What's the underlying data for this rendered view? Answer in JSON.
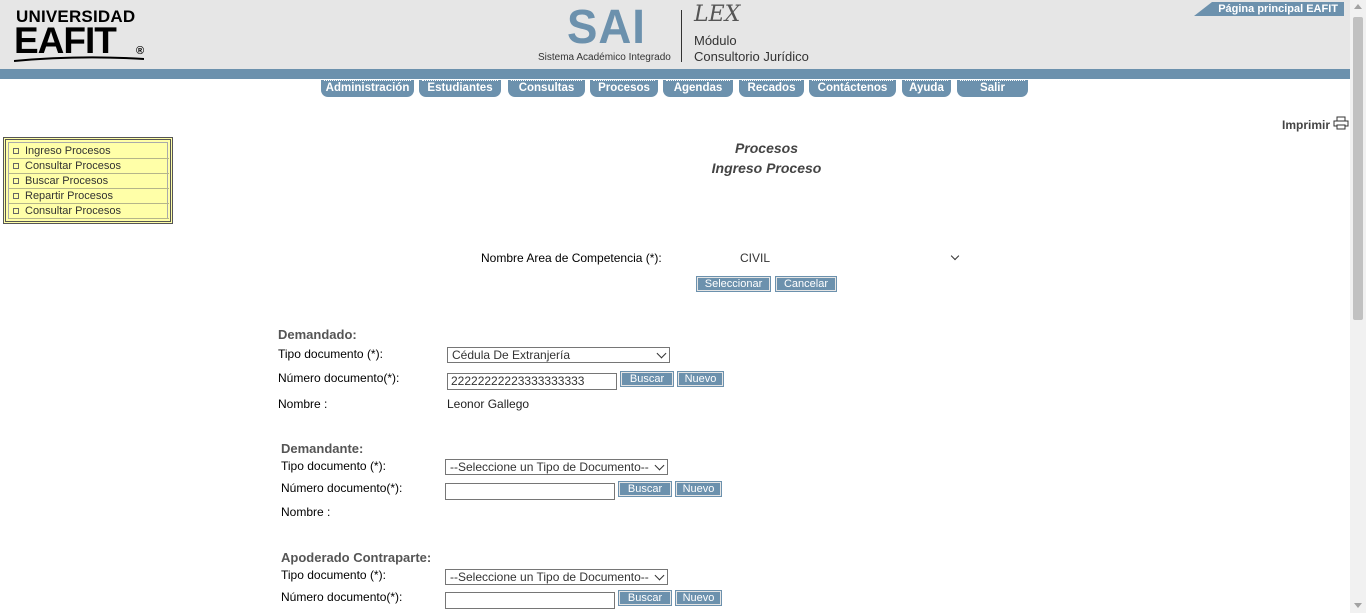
{
  "header": {
    "logo_line1": "UNIVERSIDAD",
    "logo_line2": "EAFIT",
    "logo_reg": "®",
    "sai": "SAI",
    "sai_subtitle": "Sistema Académico Integrado",
    "lex": "LEX",
    "module_line1": "Módulo",
    "module_line2": "Consultorio Jurídico",
    "home_link": "Página principal EAFIT"
  },
  "nav": {
    "items": [
      "Administración",
      "Estudiantes",
      "Consultas",
      "Procesos",
      "Agendas",
      "Recados",
      "Contáctenos",
      "Ayuda",
      "Salir"
    ]
  },
  "print_label": "Imprimir",
  "sidebar": {
    "items": [
      "Ingreso Procesos",
      "Consultar Procesos",
      "Buscar Procesos",
      "Repartir Procesos",
      "Consultar Procesos"
    ]
  },
  "page": {
    "title": "Procesos",
    "subtitle": "Ingreso Proceso"
  },
  "area": {
    "label": "Nombre Area de Competencia (*):",
    "value": "CIVIL",
    "select_button": "Seleccionar",
    "cancel_button": "Cancelar"
  },
  "demandado": {
    "heading": "Demandado:",
    "doc_type_label": "Tipo documento (*):",
    "doc_type_value": "Cédula De Extranjería",
    "doc_number_label": "Número documento(*):",
    "doc_number_value": "22222222223333333333",
    "search_button": "Buscar",
    "new_button": "Nuevo",
    "name_label": "Nombre :",
    "name_value": "Leonor Gallego"
  },
  "demandante": {
    "heading": "Demandante:",
    "doc_type_label": "Tipo documento (*):",
    "doc_type_value": "--Seleccione un Tipo de Documento--",
    "doc_number_label": "Número documento(*):",
    "doc_number_value": "",
    "search_button": "Buscar",
    "new_button": "Nuevo",
    "name_label": "Nombre :"
  },
  "apoderado": {
    "heading": "Apoderado Contraparte:",
    "doc_type_label": "Tipo documento (*):",
    "doc_type_value": "--Seleccione un Tipo de Documento--",
    "doc_number_label": "Número documento(*):",
    "doc_number_value": "",
    "search_button": "Buscar",
    "new_button": "Nuevo"
  },
  "colors": {
    "accent": "#6c91ad",
    "menu_bg": "#ffffa8",
    "header_bg": "#e6e6e6"
  }
}
